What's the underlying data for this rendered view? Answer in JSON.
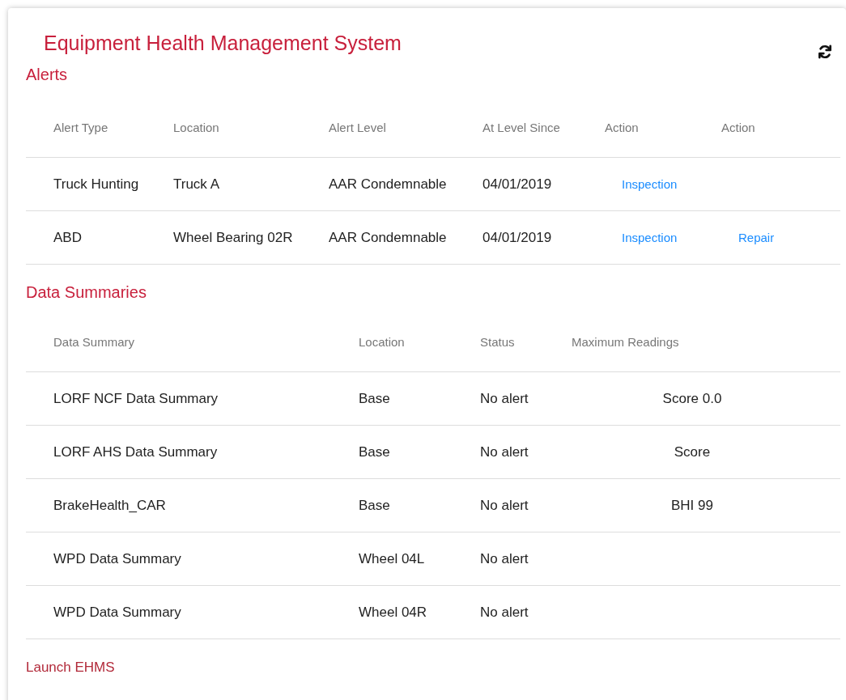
{
  "title": "Equipment Health Management System",
  "alerts": {
    "heading": "Alerts",
    "columns": [
      "Alert Type",
      "Location",
      "Alert Level",
      "At Level Since",
      "Action",
      "Action"
    ],
    "rows": [
      {
        "alert_type": "Truck Hunting",
        "location": "Truck A",
        "alert_level": "AAR Condemnable",
        "since": "04/01/2019",
        "actions": [
          "Inspection"
        ]
      },
      {
        "alert_type": "ABD",
        "location": "Wheel Bearing 02R",
        "alert_level": "AAR Condemnable",
        "since": "04/01/2019",
        "actions": [
          "Inspection",
          "Repair"
        ]
      }
    ]
  },
  "data_summaries": {
    "heading": "Data Summaries",
    "columns": [
      "Data Summary",
      "Location",
      "Status",
      "Maximum Readings"
    ],
    "rows": [
      {
        "name": "LORF NCF Data Summary",
        "location": "Base",
        "status": "No alert",
        "max": "Score 0.0"
      },
      {
        "name": "LORF AHS Data Summary",
        "location": "Base",
        "status": "No alert",
        "max": "Score"
      },
      {
        "name": "BrakeHealth_CAR",
        "location": "Base",
        "status": "No alert",
        "max": "BHI 99"
      },
      {
        "name": "WPD Data Summary",
        "location": "Wheel 04L",
        "status": "No alert"
      },
      {
        "name": "WPD Data Summary",
        "location": "Wheel 04R",
        "status": "No alert"
      }
    ]
  },
  "launch_link": "Launch EHMS"
}
